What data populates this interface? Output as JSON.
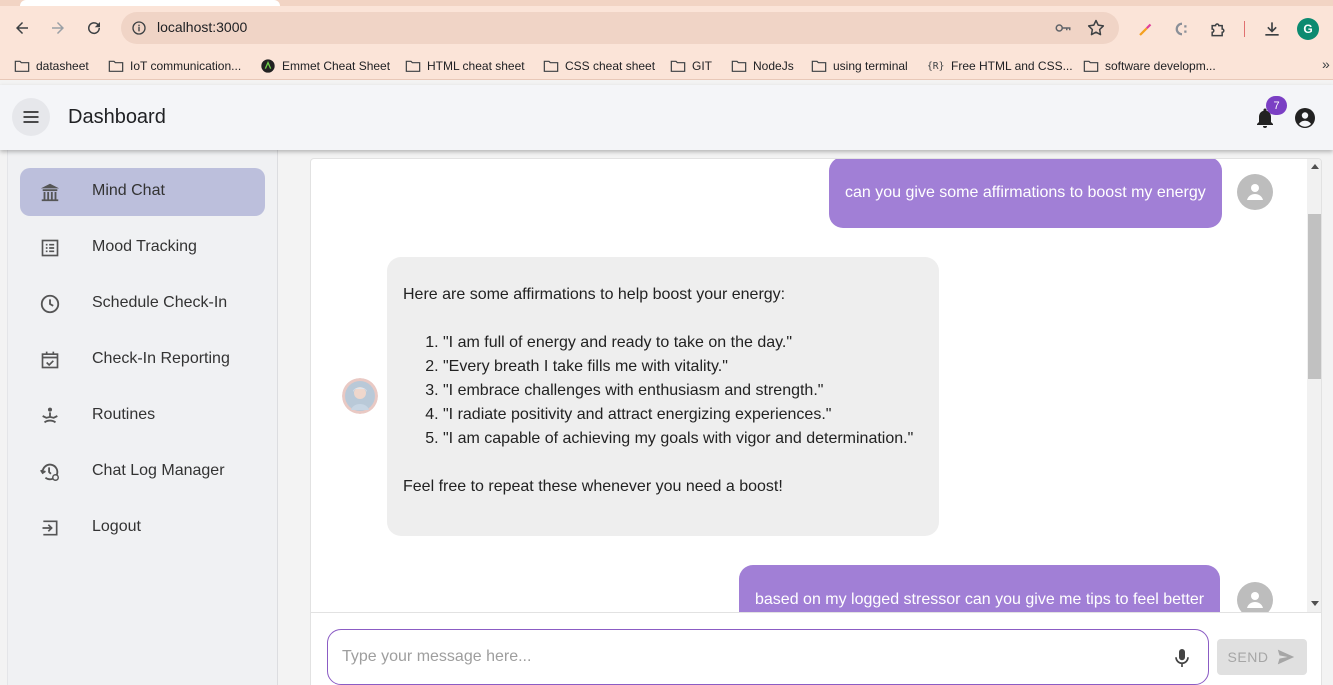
{
  "browser": {
    "url": "localhost:3000",
    "profile_initial": "G",
    "bookmarks": [
      {
        "label": "datasheet",
        "icon": "folder-icon"
      },
      {
        "label": "IoT communication...",
        "icon": "folder-icon"
      },
      {
        "label": "Emmet Cheat Sheet",
        "icon": "emmet-icon"
      },
      {
        "label": "HTML cheat sheet",
        "icon": "folder-icon"
      },
      {
        "label": "CSS cheat sheet",
        "icon": "folder-icon"
      },
      {
        "label": "GIT",
        "icon": "folder-icon"
      },
      {
        "label": "NodeJs",
        "icon": "folder-icon"
      },
      {
        "label": "using terminal",
        "icon": "folder-icon"
      },
      {
        "label": "Free HTML and CSS...",
        "icon": "r-icon"
      },
      {
        "label": "software developm...",
        "icon": "folder-icon"
      }
    ],
    "bookmarks_more": "»"
  },
  "appbar": {
    "title": "Dashboard",
    "notification_count": "7"
  },
  "sidebar": {
    "items": [
      {
        "label": "Mind Chat",
        "icon": "temple-icon",
        "active": true
      },
      {
        "label": "Mood Tracking",
        "icon": "list-icon",
        "active": false
      },
      {
        "label": "Schedule Check-In",
        "icon": "clock-icon",
        "active": false
      },
      {
        "label": "Check-In Reporting",
        "icon": "calendar-check-icon",
        "active": false
      },
      {
        "label": "Routines",
        "icon": "meditation-icon",
        "active": false
      },
      {
        "label": "Chat Log Manager",
        "icon": "history-settings-icon",
        "active": false
      },
      {
        "label": "Logout",
        "icon": "logout-icon",
        "active": false
      }
    ]
  },
  "chat": {
    "messages": [
      {
        "role": "user",
        "text": "can you give some affirmations to boost my energy"
      },
      {
        "role": "bot",
        "intro": "Here are some affirmations to help boost your energy:",
        "items": [
          "\"I am full of energy and ready to take on the day.\"",
          "\"Every breath I take fills me with vitality.\"",
          "\"I embrace challenges with enthusiasm and strength.\"",
          "\"I radiate positivity and attract energizing experiences.\"",
          "\"I am capable of achieving my goals with vigor and determination.\""
        ],
        "outro": "Feel free to repeat these whenever you need a boost!"
      },
      {
        "role": "user",
        "text": "based on my logged stressor can you give me tips to feel better"
      }
    ]
  },
  "input": {
    "placeholder": "Type your message here...",
    "value": "",
    "send_label": "SEND"
  },
  "colors": {
    "accent": "#a17fd6",
    "active_nav": "#bcbfdc",
    "badge": "#7b3fc4"
  }
}
